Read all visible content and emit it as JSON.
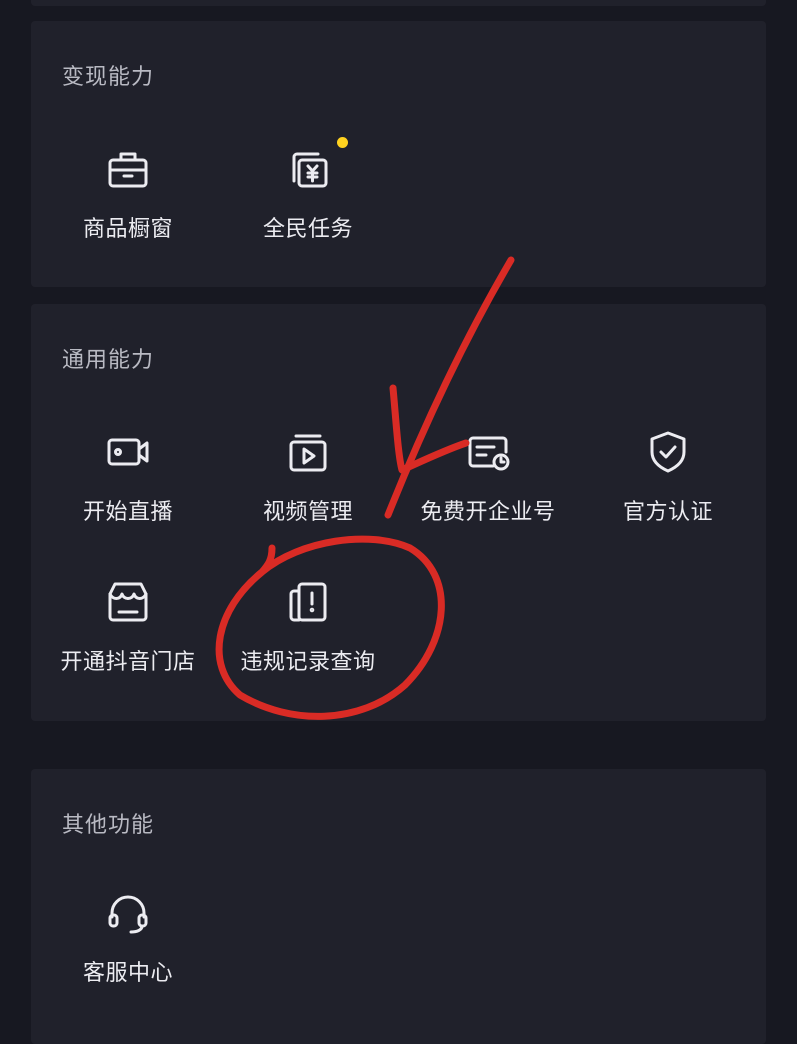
{
  "sections": [
    {
      "title": "变现能力",
      "items": [
        {
          "label": "商品橱窗",
          "icon": "briefcase-icon"
        },
        {
          "label": "全民任务",
          "icon": "yuan-cards-icon",
          "badge": "new-dot"
        }
      ]
    },
    {
      "title": "通用能力",
      "items": [
        {
          "label": "开始直播",
          "icon": "video-camera-icon"
        },
        {
          "label": "视频管理",
          "icon": "video-play-icon"
        },
        {
          "label": "免费开企业号",
          "icon": "enterprise-card-clock-icon"
        },
        {
          "label": "官方认证",
          "icon": "shield-check-icon"
        },
        {
          "label": "开通抖音门店",
          "icon": "store-icon"
        },
        {
          "label": "违规记录查询",
          "icon": "violation-record-icon"
        }
      ]
    },
    {
      "title": "其他功能",
      "items": [
        {
          "label": "客服中心",
          "icon": "headset-icon"
        }
      ]
    }
  ],
  "colors": {
    "background": "#171821",
    "card": "#20212b",
    "section_title": "#b9bac3",
    "label": "#ececf1",
    "badge_dot": "#ffd21f",
    "annotation": "#d92b25"
  }
}
